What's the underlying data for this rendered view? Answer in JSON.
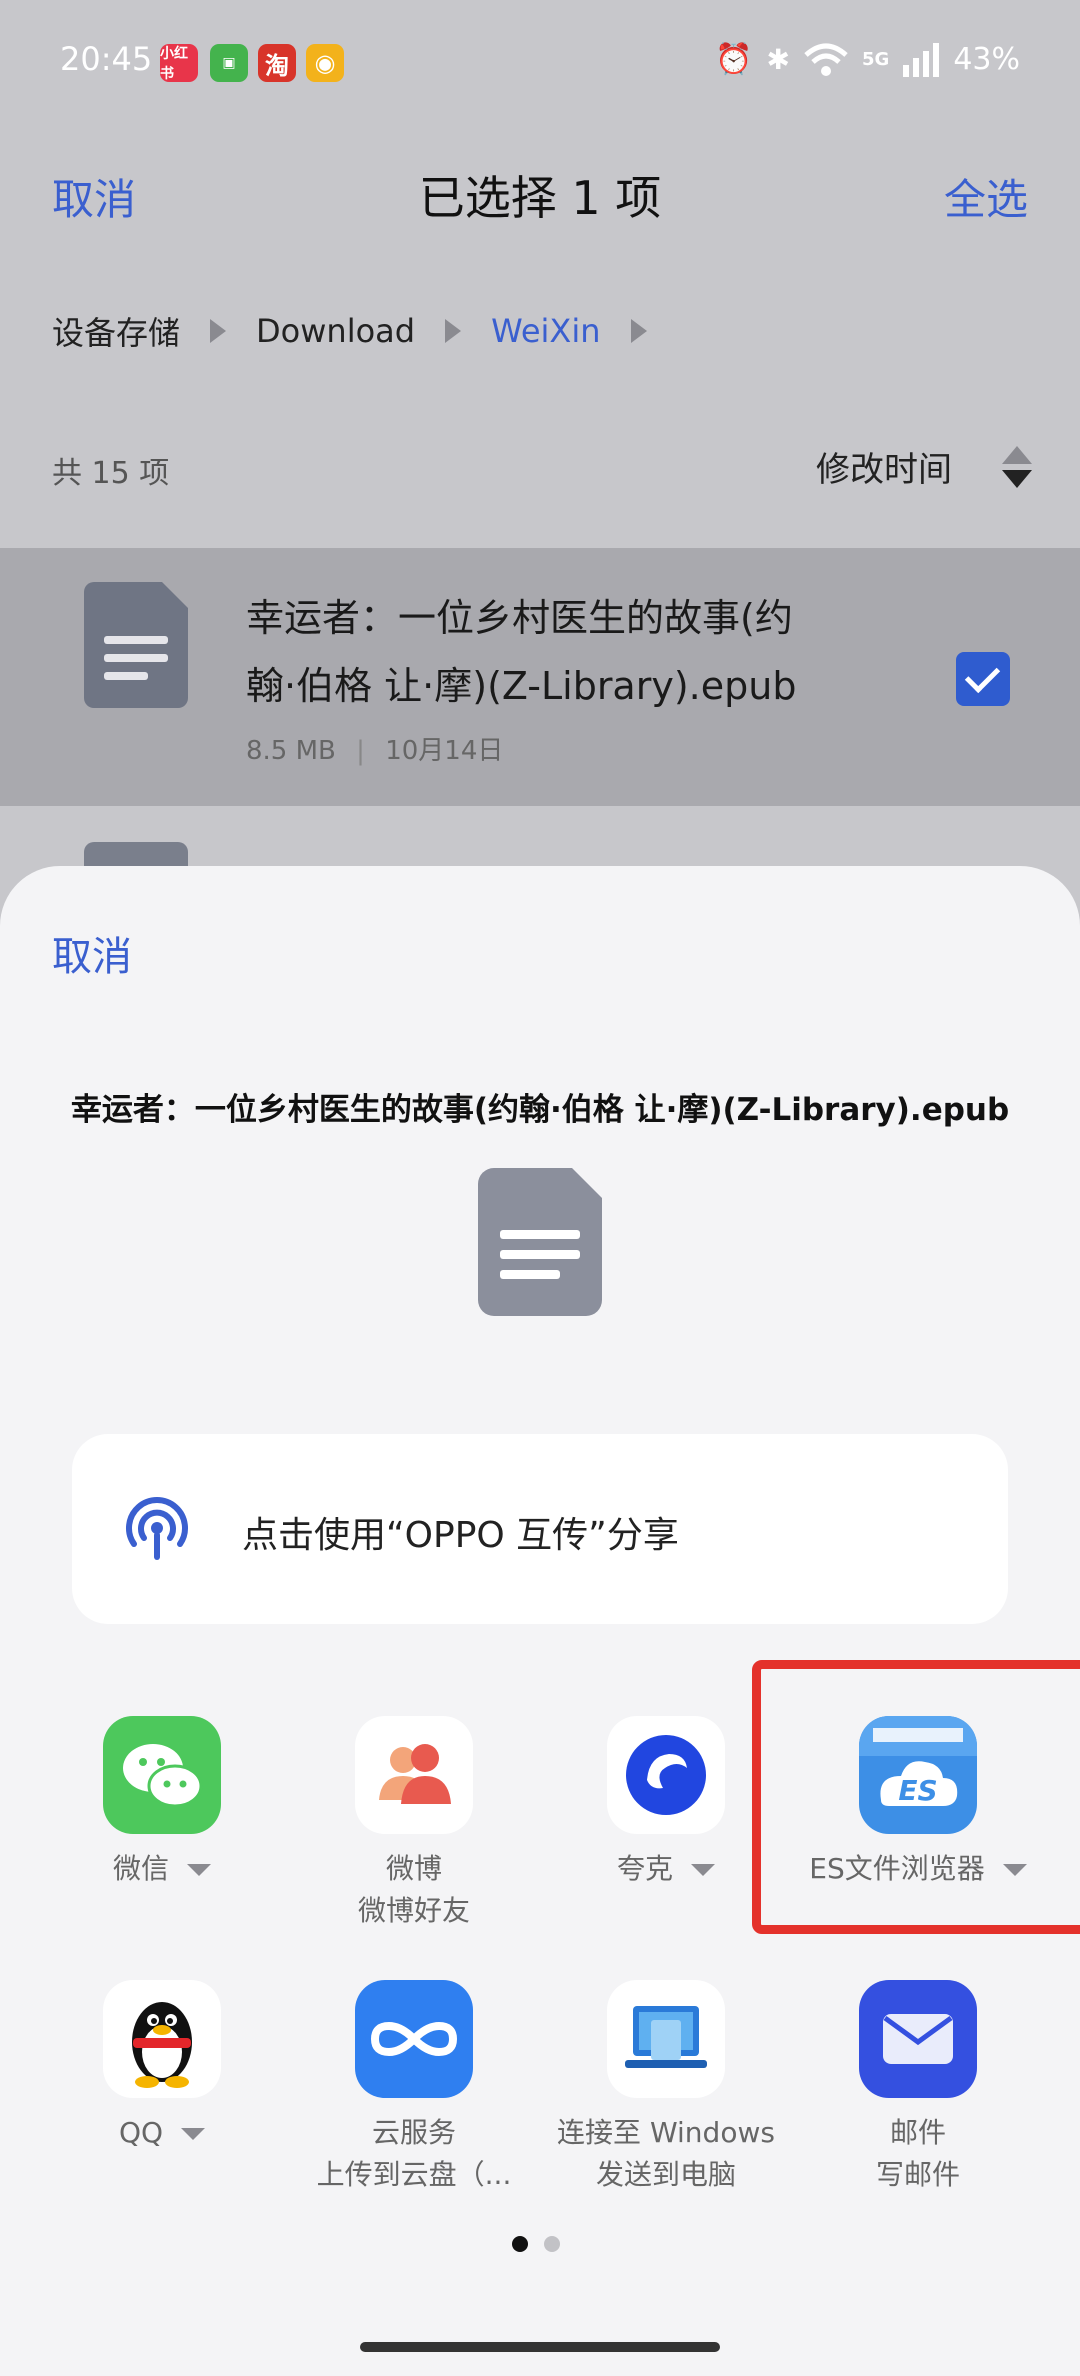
{
  "status": {
    "time": "20:45",
    "battery": "43%",
    "network": "5G"
  },
  "status_apps": [
    {
      "label": "小红书",
      "color": "#e8354a"
    },
    {
      "label": "▣",
      "color": "#44b34d"
    },
    {
      "label": "淘",
      "color": "#d8342a"
    },
    {
      "label": "◉",
      "color": "#f3b21b"
    }
  ],
  "header": {
    "cancel": "取消",
    "title": "已选择 1 项",
    "select_all": "全选"
  },
  "breadcrumb": [
    {
      "label": "设备存储",
      "active": false
    },
    {
      "label": "Download",
      "active": false
    },
    {
      "label": "WeiXin",
      "active": true
    }
  ],
  "list": {
    "count": "共 15 项",
    "sort_label": "修改时间"
  },
  "file": {
    "title_line1": "幸运者：一位乡村医生的故事(约",
    "title_line2": "翰·伯格 让·摩)(Z-Library).epub",
    "size": "8.5 MB",
    "date": "10月14日"
  },
  "sheet": {
    "cancel": "取消",
    "filename": "幸运者：一位乡村医生的故事(约翰·伯格 让·摩)(Z-Library).epub",
    "oppo_share": "点击使用“OPPO 互传”分享"
  },
  "apps": [
    {
      "label": "微信",
      "sub": "",
      "dropdown": true,
      "icon": "wechat-icon",
      "color": "#4dc85c"
    },
    {
      "label": "微博",
      "sub": "微博好友",
      "dropdown": false,
      "icon": "weibo-friends-icon",
      "color": "#ffffff"
    },
    {
      "label": "夸克",
      "sub": "",
      "dropdown": true,
      "icon": "quark-icon",
      "color": "#ffffff"
    },
    {
      "label": "ES文件浏览器",
      "sub": "",
      "dropdown": true,
      "icon": "es-file-explorer-icon",
      "color": "#3d8fe6"
    },
    {
      "label": "QQ",
      "sub": "",
      "dropdown": true,
      "icon": "qq-penguin-icon",
      "color": "#ffffff"
    },
    {
      "label": "云服务",
      "sub": "上传到云盘（...",
      "dropdown": false,
      "icon": "cloud-service-icon",
      "color": "#2f7ff0"
    },
    {
      "label": "连接至 Windows",
      "sub": "发送到电脑",
      "dropdown": false,
      "icon": "connect-windows-icon",
      "color": "#ffffff"
    },
    {
      "label": "邮件",
      "sub": "写邮件",
      "dropdown": false,
      "icon": "mail-icon",
      "color": "#3450e0"
    }
  ],
  "accent": "#3a5fcf",
  "highlight_color": "#e4312b"
}
